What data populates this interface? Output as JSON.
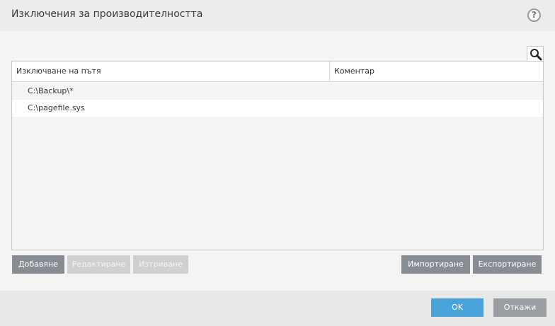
{
  "window": {
    "title": "Изключения за производителността",
    "help_glyph": "?"
  },
  "table": {
    "columns": [
      "Изключване на пътя",
      "Коментар"
    ],
    "rows": [
      {
        "path": "C:\\Backup\\*",
        "comment": ""
      },
      {
        "path": "C:\\pagefile.sys",
        "comment": ""
      }
    ]
  },
  "buttons": {
    "add": "Добавяне",
    "edit": "Редактиране",
    "delete": "Изтриване",
    "import": "Импортиране",
    "export": "Експортиране"
  },
  "footer": {
    "ok": "OK",
    "cancel": "Откажи"
  },
  "colors": {
    "ok_button": "#4aa3d9",
    "active_button": "#878d93",
    "disabled_button": "#d0d0d0"
  },
  "icons": {
    "help": "question-circle-icon",
    "search": "magnifier-icon"
  }
}
